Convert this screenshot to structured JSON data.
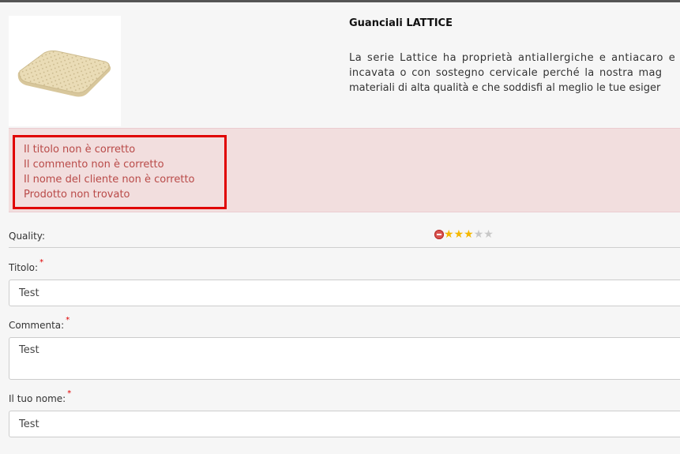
{
  "product": {
    "title": "Guanciali LATTICE",
    "description_lines": [
      "La serie Lattice ha proprietà antiallergiche e antiacaro e p",
      "incavata o con sostegno cervicale perché la nostra mag",
      "materiali di alta qualità e che soddisfi al meglio le tue esiger"
    ],
    "image_icon": "latex-pillow-image"
  },
  "alert": {
    "messages": [
      "Il titolo non è corretto",
      "Il commento non è corretto",
      "Il nome del cliente non è corretto",
      "Prodotto non trovato"
    ]
  },
  "rating": {
    "label": "Quality:",
    "value": 3,
    "max": 5,
    "cancel_icon": "cancel-rating-icon"
  },
  "form": {
    "title_label": "Titolo:",
    "title_value": "Test",
    "comment_label": "Commenta:",
    "comment_value": "Test",
    "name_label": "Il tuo nome:",
    "name_value": "Test",
    "required_mark": "*"
  },
  "colors": {
    "alert_bg": "#f2dede",
    "alert_text": "#b94a48",
    "highlight_border": "#e00000",
    "star_on": "#f5b800",
    "star_off": "#c8c8c8"
  }
}
